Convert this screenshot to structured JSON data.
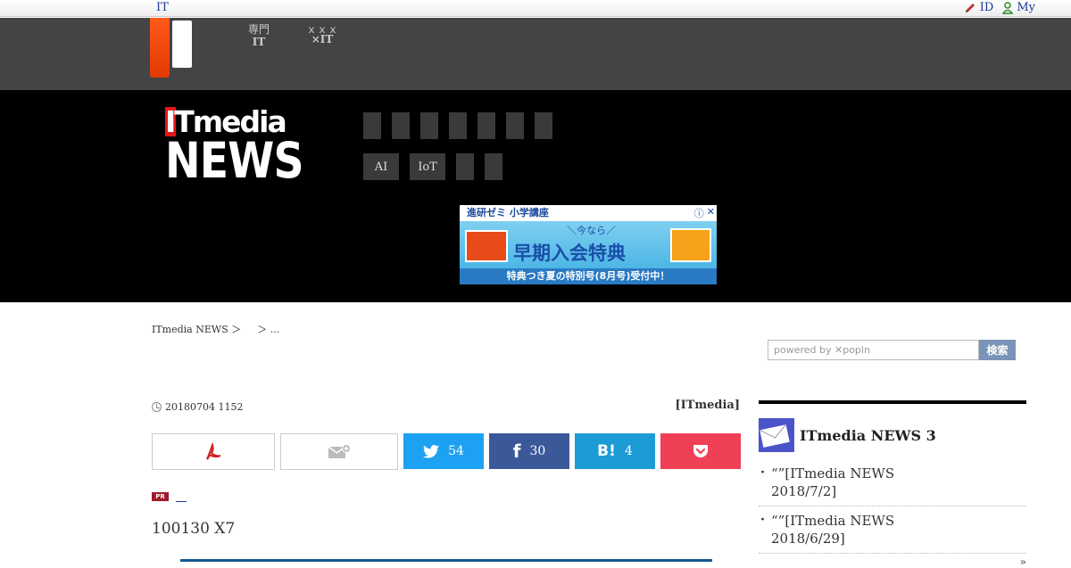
{
  "topbar": {
    "left_link": "IT",
    "id_link": "ID",
    "my_link": "My"
  },
  "gray_header": {
    "link1": {
      "line1": "専門",
      "line2": "IT"
    },
    "link2": {
      "line1": "ｘｘｘ",
      "line2": "×IT"
    }
  },
  "header": {
    "logo_top": "ITmedia",
    "logo_bottom": "NEWS",
    "nav_row1": [
      "",
      "",
      "",
      "",
      "",
      "",
      ""
    ],
    "nav_row2": [
      "AI",
      "IoT",
      "",
      ""
    ]
  },
  "ad": {
    "top_text": "進研ゼミ 小学講座",
    "small_text": "＼今なら／",
    "main_text": "早期入会特典",
    "bottom_text": "特典つき夏の特別号(8月号)受付中！"
  },
  "breadcrumb": [
    "ITmedia NEWS ＞",
    "＞ ..."
  ],
  "search": {
    "placeholder": "powered by ✕popln",
    "button": "検索"
  },
  "article": {
    "date": "20180704 1152",
    "author": "[ITmedia]",
    "pr_link": "＿",
    "headline": "100130 X7"
  },
  "share": {
    "twitter_count": "54",
    "facebook_count": "30",
    "hatena_count": "4"
  },
  "colors": {
    "twitter": "#1da1f2",
    "facebook": "#3b5998",
    "hatena": "#1d9bd7",
    "pocket": "#ef4056",
    "pdf": "#cc2222"
  },
  "sidebar": {
    "title": "ITmedia NEWS 3",
    "items": [
      {
        "line1": "“”[ITmedia NEWS",
        "line2": "2018/7/2]"
      },
      {
        "line1": "“”[ITmedia NEWS",
        "line2": "2018/6/29]"
      }
    ],
    "more": "»"
  }
}
